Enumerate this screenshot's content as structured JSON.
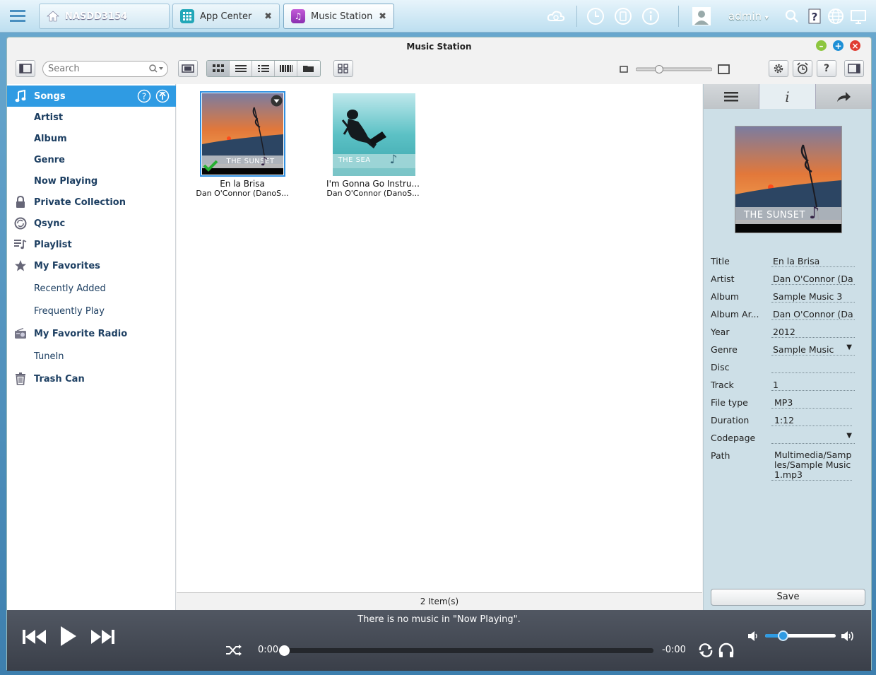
{
  "topbar": {
    "nas_name": "NASDD3154",
    "tabs": [
      {
        "label": "App Center",
        "close": "✖"
      },
      {
        "label": "Music Station",
        "close": "✖"
      }
    ],
    "user": "admin"
  },
  "window": {
    "title": "Music Station"
  },
  "toolbar": {
    "search_placeholder": "Search"
  },
  "sidebar": {
    "items": [
      {
        "label": "Songs"
      },
      {
        "label": "Artist"
      },
      {
        "label": "Album"
      },
      {
        "label": "Genre"
      },
      {
        "label": "Now Playing"
      },
      {
        "label": "Private Collection"
      },
      {
        "label": "Qsync"
      },
      {
        "label": "Playlist"
      },
      {
        "label": "My Favorites"
      },
      {
        "label": "Recently Added"
      },
      {
        "label": "Frequently Play"
      },
      {
        "label": "My Favorite Radio"
      },
      {
        "label": "TuneIn"
      },
      {
        "label": "Trash Can"
      }
    ]
  },
  "content": {
    "cards": [
      {
        "title": "En la Brisa",
        "artist": "Dan O'Connor (DanoS...",
        "cover_caption": "THE SUNSET",
        "selected": true
      },
      {
        "title": "I'm Gonna Go Instru...",
        "artist": "Dan O'Connor (DanoS...",
        "cover_caption": "THE SEA",
        "selected": false
      }
    ],
    "status": "2 Item(s)"
  },
  "panel": {
    "cover_caption": "THE SUNSET",
    "fields": [
      {
        "key": "Title",
        "value": "En la Brisa"
      },
      {
        "key": "Artist",
        "value": "Dan O'Connor (Da"
      },
      {
        "key": "Album",
        "value": "Sample Music 3"
      },
      {
        "key": "Album Ar...",
        "value": "Dan O'Connor (Da"
      },
      {
        "key": "Year",
        "value": "2012"
      },
      {
        "key": "Genre",
        "value": "Sample Music"
      },
      {
        "key": "Disc",
        "value": ""
      },
      {
        "key": "Track",
        "value": "1"
      },
      {
        "key": "File type",
        "value": "MP3"
      },
      {
        "key": "Duration",
        "value": "1:12"
      },
      {
        "key": "Codepage",
        "value": ""
      },
      {
        "key": "Path",
        "value": "Multimedia/Samples/Sample Music 1.mp3"
      }
    ],
    "save_label": "Save"
  },
  "player": {
    "message": "There is no music in \"Now Playing\".",
    "time_elapsed": "0:00",
    "time_remaining": "-0:00",
    "progress": 0,
    "volume": 0.25
  },
  "colors": {
    "accent": "#2f9be3",
    "player_bg": "#454a54",
    "panel_bg": "#cddfe7"
  }
}
